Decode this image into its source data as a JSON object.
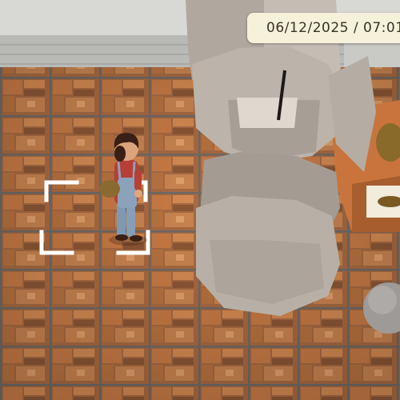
{
  "hud": {
    "datetime": "06/12/2025 / 07:01"
  },
  "scene": {
    "floor_color": "#9b6540",
    "wall_color": "#d6d6d2",
    "pillar_color": "#b8b0a6",
    "selection_marker_color": "#ffffff"
  }
}
